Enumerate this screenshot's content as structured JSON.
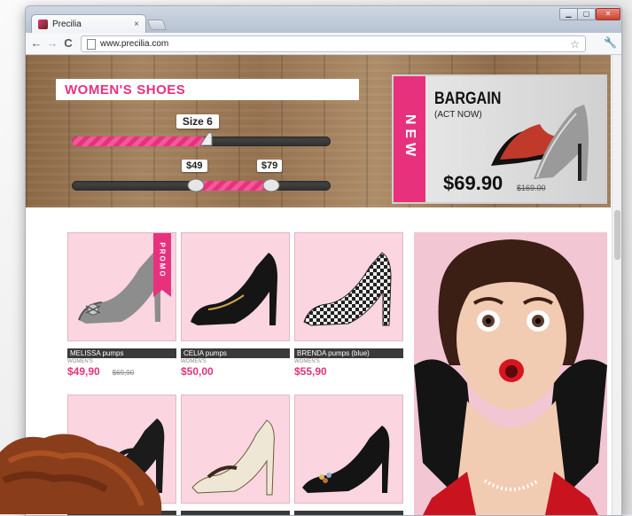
{
  "browser": {
    "tab_title": "Precilia",
    "tab_close": "×",
    "url": "www.precilia.com",
    "nav_back": "←",
    "nav_forward": "→",
    "nav_reload": "C",
    "window_min": "▁",
    "window_max": "▢",
    "window_close": "✕"
  },
  "hero": {
    "title_part1": "WOMEN'S",
    "title_part2": "SHOES",
    "size_label": "Size 6",
    "size_fraction": 0.52,
    "price_min_label": "$49",
    "price_max_label": "$79",
    "price_range_fraction": [
      0.48,
      0.77
    ]
  },
  "promo": {
    "badge": "NEW",
    "headline": "BARGAIN",
    "subline": "(ACT NOW)",
    "price": "$69.90",
    "old_price": "$169.00"
  },
  "products": [
    {
      "name": "MELISSA pumps",
      "brand": "WOMEN'S",
      "price": "$49,90",
      "old_price": "$69,90",
      "badge": "PROMO"
    },
    {
      "name": "CELIA pumps",
      "brand": "WOMEN'S",
      "price": "$50,00"
    },
    {
      "name": "BRENDA pumps (blue)",
      "brand": "WOMEN'S",
      "price": "$55,90"
    },
    {
      "name": ""
    },
    {
      "name": ""
    },
    {
      "name": ""
    }
  ],
  "colors": {
    "accent": "#e8317d",
    "tile": "#fbd6e1",
    "label_bar": "#3a3a3a"
  }
}
